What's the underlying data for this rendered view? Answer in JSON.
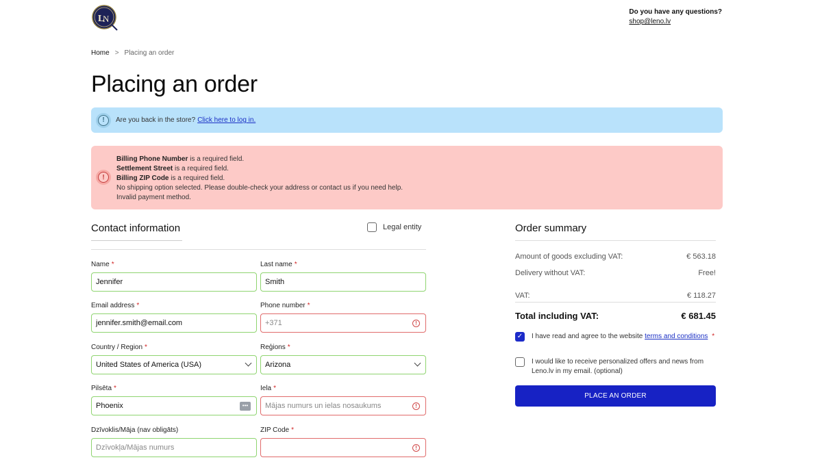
{
  "header": {
    "help_title": "Do you have any questions?",
    "help_email": "shop@leno.lv"
  },
  "breadcrumb": {
    "home": "Home",
    "separator": ">",
    "current": "Placing an order"
  },
  "page_title": "Placing an order",
  "info_notice": {
    "text": "Are you back in the store?",
    "link": "Click here to log in.",
    "icon": "!"
  },
  "error_notice": {
    "icon": "!",
    "lines": [
      {
        "bold": "Billing Phone Number",
        "rest": " is a required field."
      },
      {
        "bold": "Settlement Street",
        "rest": " is a required field."
      },
      {
        "bold": "Billing ZIP Code",
        "rest": " is a required field."
      },
      {
        "bold": "",
        "rest": "No shipping option selected. Please double-check your address or contact us if you need help."
      },
      {
        "bold": "",
        "rest": "Invalid payment method."
      }
    ]
  },
  "contact": {
    "title": "Contact information",
    "legal_entity": "Legal entity",
    "required_mark": "*",
    "fields": {
      "name": {
        "label": "Name",
        "value": "Jennifer"
      },
      "last_name": {
        "label": "Last name",
        "value": "Smith"
      },
      "email": {
        "label": "Email address",
        "value": "jennifer.smith@email.com"
      },
      "phone": {
        "label": "Phone number",
        "placeholder": "+371"
      },
      "country": {
        "label": "Country / Region",
        "value": "United States of America (USA)"
      },
      "region": {
        "label": "Reģions",
        "value": "Arizona"
      },
      "city": {
        "label": "Pilsēta",
        "value": "Phoenix"
      },
      "street": {
        "label": "Iela",
        "placeholder": "Mājas numurs un ielas nosaukums"
      },
      "apartment": {
        "label": "Dzīvoklis/Māja (nav obligāts)",
        "placeholder": "Dzīvokļa/Mājas numurs"
      },
      "zip": {
        "label": "ZIP Code",
        "placeholder": ""
      }
    }
  },
  "summary": {
    "title": "Order summary",
    "goods_label": "Amount of goods excluding VAT:",
    "goods_value": "€ 563.18",
    "delivery_label": "Delivery without VAT:",
    "delivery_value": "Free!",
    "vat_label": "VAT:",
    "vat_value": "€ 118.27",
    "total_label": "Total including VAT:",
    "total_value": "€ 681.45",
    "terms_prefix": "I have read and agree to the website",
    "terms_link": "terms and conditions",
    "terms_req": "*",
    "offers_text": "I would like to receive personalized offers and news from Leno.lv in my email.",
    "offers_optional": "(optional)",
    "checkmark": "✓",
    "place_order": "PLACE AN ORDER"
  },
  "colors": {
    "accent": "#1722c4",
    "info_bg": "#b9e2fb",
    "error_bg": "#fdcac7",
    "valid_border": "#8ed46f",
    "invalid_border": "#e06a6a"
  }
}
